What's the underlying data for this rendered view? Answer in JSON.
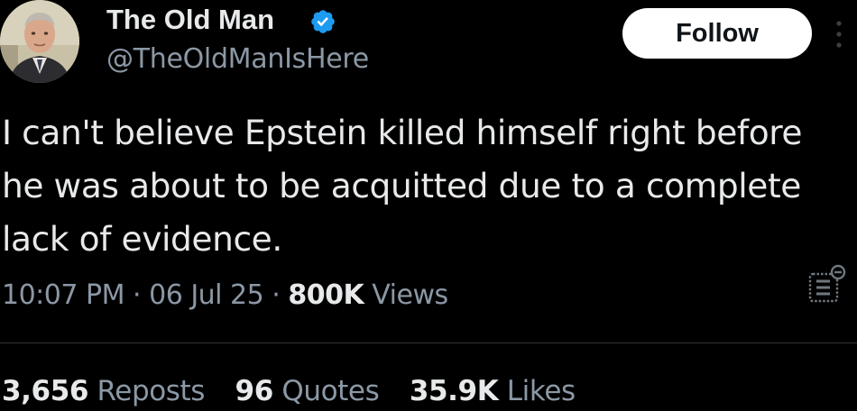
{
  "author": {
    "display_name": "The Old Man",
    "handle": "@TheOldManIsHere",
    "verified_icon": "verified-badge-icon",
    "avatar_icon": "profile-photo"
  },
  "actions": {
    "follow_label": "Follow",
    "more_icon": "more-vertical-icon"
  },
  "tweet": {
    "text": "I can't believe Epstein killed himself right before he was about to be acquitted due to a complete lack of evidence."
  },
  "meta": {
    "time": "10:07 PM",
    "separator": "·",
    "date": "06 Jul 25",
    "views_count": "800K",
    "views_label": "Views",
    "analytics_icon": "analytics-icon"
  },
  "stats": {
    "reposts_count": "3,656",
    "reposts_label": "Reposts",
    "quotes_count": "96",
    "quotes_label": "Quotes",
    "likes_count": "35.9K",
    "likes_label": "Likes"
  },
  "colors": {
    "background": "#000000",
    "primary_text": "#e7e9ea",
    "secondary_text": "#8b98a5",
    "verified": "#1d9bf0",
    "divider": "#2f3336"
  }
}
